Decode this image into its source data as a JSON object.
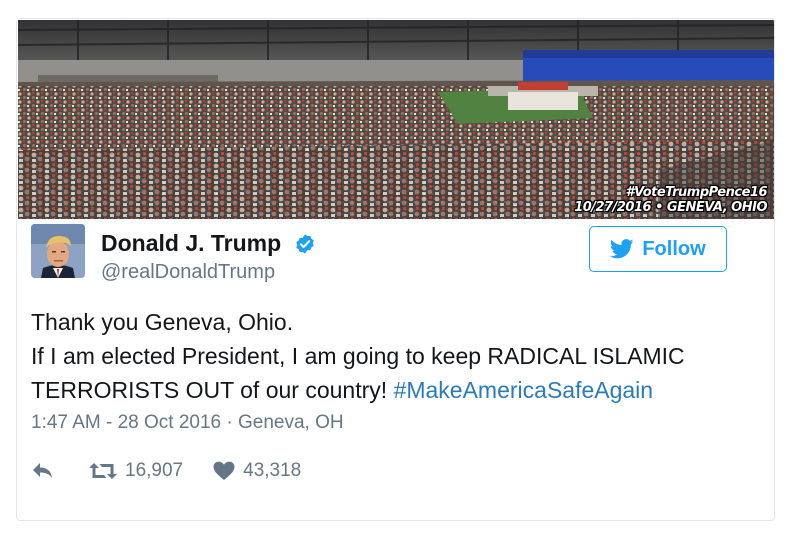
{
  "photo": {
    "caption_line1": "#VoteTrumpPence16",
    "caption_line2": "10/27/2016 • GENEVA, OHIO"
  },
  "author": {
    "display_name": "Donald J. Trump",
    "handle": "@realDonaldTrump",
    "verified": true
  },
  "follow_button": {
    "label": "Follow"
  },
  "tweet": {
    "line1": "Thank you Geneva, Ohio.",
    "line2": "If I am elected President, I am going to keep RADICAL ISLAMIC",
    "line3_text": "TERRORISTS OUT of our country! ",
    "line3_hashtag": "#MakeAmericaSafeAgain"
  },
  "meta": {
    "timestamp": "1:47 AM - 28 Oct 2016",
    "separator": "·",
    "location": "Geneva, OH"
  },
  "stats": {
    "retweets": "16,907",
    "likes": "43,318"
  },
  "colors": {
    "accent": "#1da1f2",
    "hashtag": "#2b7bb9",
    "secondary_text": "#657786",
    "border": "#e1e8ed"
  }
}
